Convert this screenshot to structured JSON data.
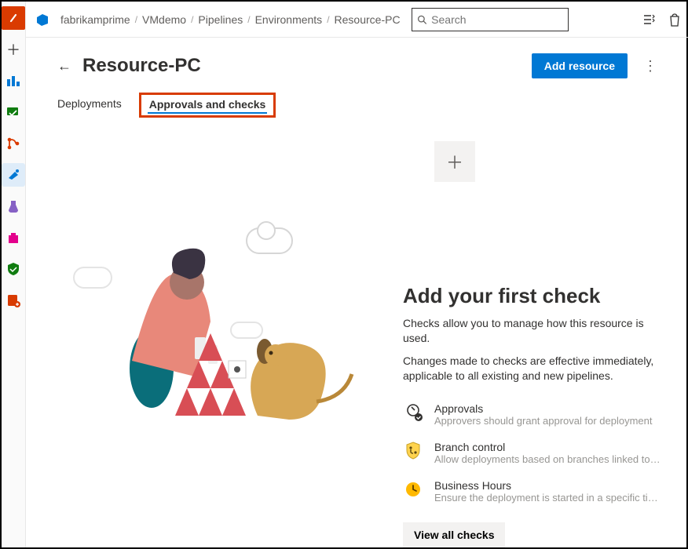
{
  "breadcrumbs": {
    "items": [
      "fabrikamprime",
      "VMdemo",
      "Pipelines",
      "Environments",
      "Resource-PC"
    ]
  },
  "search": {
    "placeholder": "Search"
  },
  "page": {
    "title": "Resource-PC",
    "add_button": "Add resource"
  },
  "tabs": {
    "deployments": "Deployments",
    "approvals": "Approvals and checks"
  },
  "checks": {
    "heading": "Add your first check",
    "p1": "Checks allow you to manage how this resource is used.",
    "p2": "Changes made to checks are effective immediately, applicable to all existing and new pipelines.",
    "items": [
      {
        "title": "Approvals",
        "desc": "Approvers should grant approval for deployment"
      },
      {
        "title": "Branch control",
        "desc": "Allow deployments based on branches linked to the run"
      },
      {
        "title": "Business Hours",
        "desc": "Ensure the deployment is started in a specific time win…"
      }
    ],
    "view_all": "View all checks"
  }
}
